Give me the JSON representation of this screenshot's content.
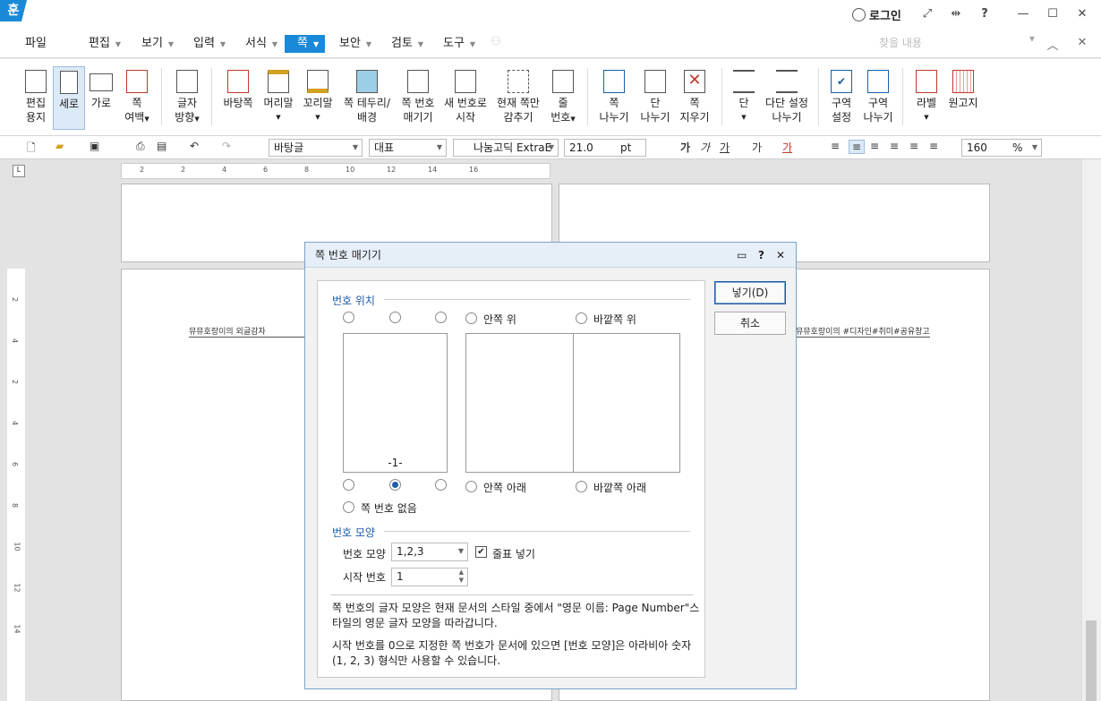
{
  "app": {
    "logo": "훈",
    "login": "로그인",
    "help": "?"
  },
  "menu": {
    "file": "파일",
    "items": [
      "편집",
      "보기",
      "입력",
      "서식",
      "쪽",
      "보안",
      "검토",
      "도구"
    ],
    "active_index": 4,
    "search_placeholder": "찾을 내용"
  },
  "ribbon": {
    "buttons": [
      {
        "label1": "편집",
        "label2": "용지"
      },
      {
        "label1": "세로",
        "label2": ""
      },
      {
        "label1": "가로",
        "label2": ""
      },
      {
        "label1": "쪽",
        "label2": "여백"
      },
      {
        "label1": "글자",
        "label2": "방향"
      },
      {
        "label1": "바탕쪽",
        "label2": ""
      },
      {
        "label1": "머리말",
        "label2": ""
      },
      {
        "label1": "꼬리말",
        "label2": ""
      },
      {
        "label1": "쪽 테두리/",
        "label2": "배경"
      },
      {
        "label1": "쪽 번호",
        "label2": "매기기"
      },
      {
        "label1": "새 번호로",
        "label2": "시작"
      },
      {
        "label1": "현재 쪽만",
        "label2": "감추기"
      },
      {
        "label1": "줄",
        "label2": "번호"
      },
      {
        "label1": "쪽",
        "label2": "나누기"
      },
      {
        "label1": "단",
        "label2": "나누기"
      },
      {
        "label1": "쪽",
        "label2": "지우기"
      },
      {
        "label1": "단",
        "label2": ""
      },
      {
        "label1": "다단 설정",
        "label2": "나누기"
      },
      {
        "label1": "구역",
        "label2": "설정"
      },
      {
        "label1": "구역",
        "label2": "나누기"
      },
      {
        "label1": "라벨",
        "label2": ""
      },
      {
        "label1": "원고지",
        "label2": ""
      }
    ]
  },
  "toolbar": {
    "style": "바탕글",
    "lang": "대표",
    "font": "나눔고딕 ExtraE",
    "size": "21.0",
    "size_unit": "pt",
    "zoom": "160",
    "zoom_unit": "%"
  },
  "ruler_ticks": [
    "2",
    "2",
    "4",
    "6",
    "8",
    "10",
    "12",
    "14",
    "16"
  ],
  "vruler_ticks": [
    "2",
    "4",
    "2",
    "4",
    "6",
    "8",
    "10",
    "12",
    "14"
  ],
  "document": {
    "left_header": "뮤뮤호랑이의 외글감자",
    "right_header": "뮤뮤호랑이의 #디자인#취미#공유창고"
  },
  "dialog": {
    "title": "쪽 번호 매기기",
    "position_group": "번호 위치",
    "inner_top": "안쪽 위",
    "outer_top": "바깥쪽 위",
    "inner_bottom": "안쪽 아래",
    "outer_bottom": "바깥쪽 아래",
    "no_number": "쪽 번호 없음",
    "preview_number": "-1-",
    "shape_group": "번호 모양",
    "shape_label": "번호 모양",
    "shape_value": "1,2,3",
    "dash_label": "줄표 넣기",
    "start_label": "시작 번호",
    "start_value": "1",
    "note1a": "쪽 번호의 글자 모양은 현재 문서의 스타일 중에서 \"영문 이름: Page Number\"스",
    "note1b": "타일의 영문 글자 모양을 따라갑니다.",
    "note2a": "시작 번호를 0으로 지정한 쪽 번호가 문서에 있으면 [번호 모양]은 아라비아 숫자",
    "note2b": "(1, 2, 3) 형식만 사용할 수 있습니다.",
    "insert_button": "넣기(D)",
    "cancel_button": "취소"
  }
}
